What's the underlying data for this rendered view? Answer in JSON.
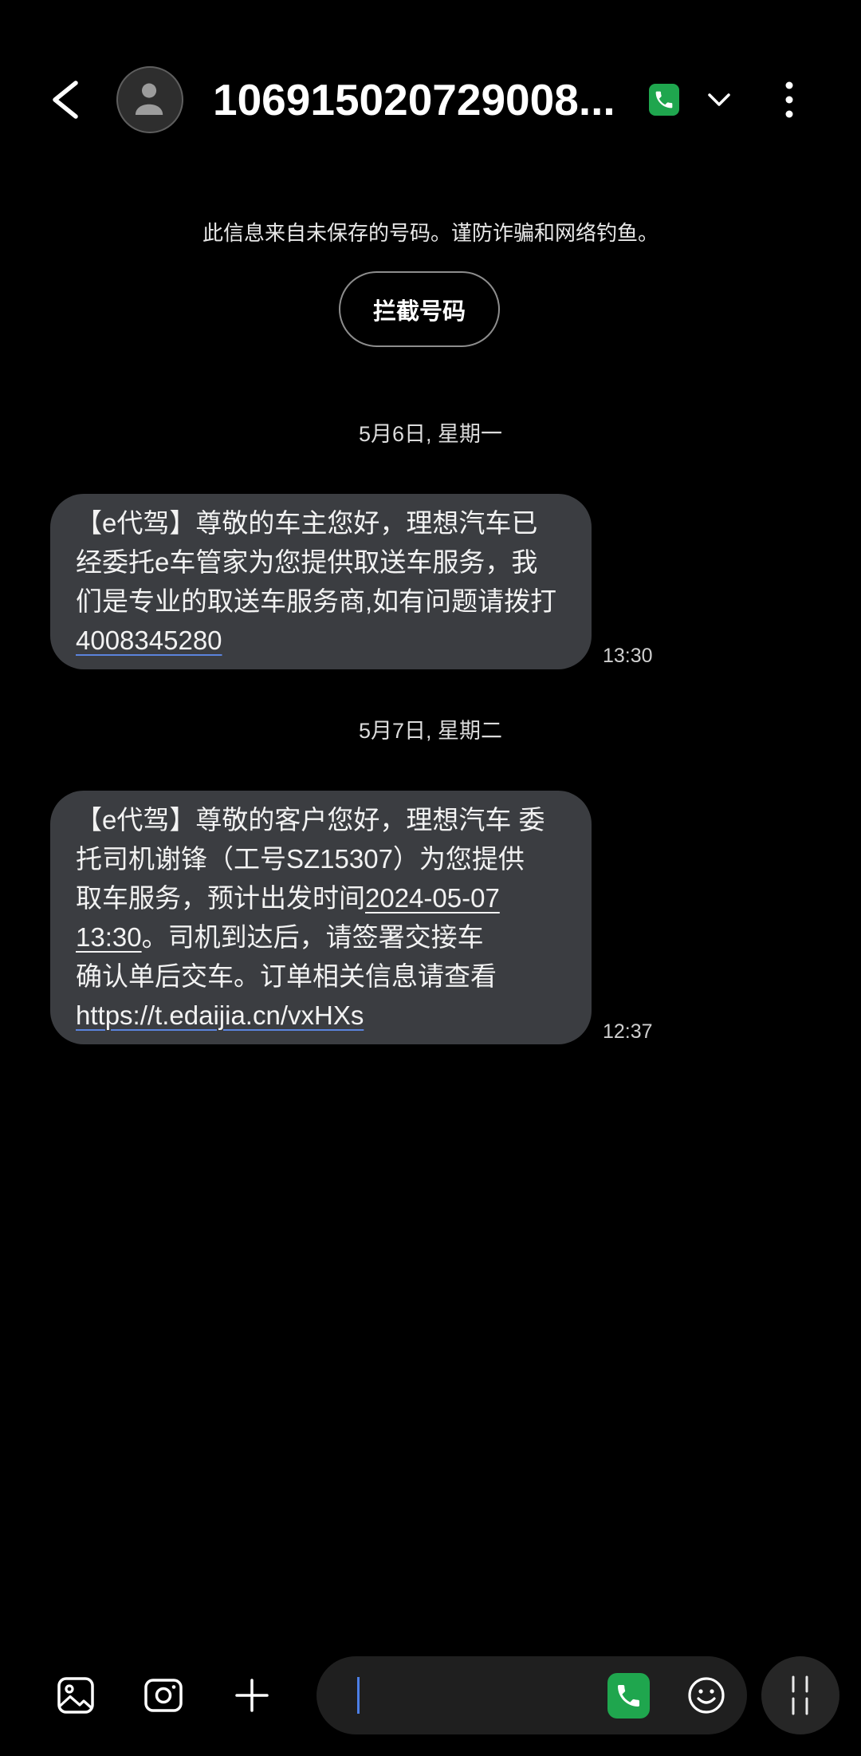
{
  "colors": {
    "background": "#000000",
    "bubble": "#3b3d41",
    "composer_field": "#1f1f1f",
    "voice_button": "#262626",
    "call_green": "#1fa64e",
    "link_underline": "#5b83dc",
    "caret": "#4c7fe6",
    "muted_text": "#cfcfcf"
  },
  "header": {
    "back_icon": "back-arrow-icon",
    "avatar_icon": "person-icon",
    "title": "106915020729008...",
    "call_icon": "phone-icon",
    "expand_icon": "chevron-down-icon",
    "menu_icon": "more-vertical-icon"
  },
  "notice": {
    "text": "此信息来自未保存的号码。谨防诈骗和网络钓鱼。",
    "block_button_label": "拦截号码"
  },
  "conversation": [
    {
      "date": "5月6日, 星期一",
      "message": {
        "lines": [
          [
            {
              "text": "【e代驾】尊敬的车主您好，理想汽车已"
            }
          ],
          [
            {
              "text": "经委托e车管家为您提供取送车服务，我"
            }
          ],
          [
            {
              "text": "们是专业的取送车服务商,如有问题请拨打"
            }
          ],
          [
            {
              "text": "4008345280",
              "link": true
            }
          ]
        ],
        "time": "13:30"
      }
    },
    {
      "date": "5月7日, 星期二",
      "message": {
        "lines": [
          [
            {
              "text": "【e代驾】尊敬的客户您好，理想汽车 委"
            }
          ],
          [
            {
              "text": "托司机谢锋（工号SZ15307）为您提供"
            }
          ],
          [
            {
              "text": "取车服务，预计出发时间"
            },
            {
              "text": "2024-05-07",
              "link": true
            }
          ],
          [
            {
              "text": "13:30",
              "link": true
            },
            {
              "text": "。司机到达后，请签署交接车"
            }
          ],
          [
            {
              "text": "确认单后交车。订单相关信息请查看"
            }
          ],
          [
            {
              "text": "https://t.edaijia.cn/vxHXs",
              "link": true
            }
          ]
        ],
        "time": "12:37"
      }
    }
  ],
  "composer": {
    "gallery_icon": "gallery-icon",
    "camera_icon": "camera-icon",
    "attach_icon": "plus-icon",
    "input_value": "",
    "call_icon": "phone-icon",
    "emoji_icon": "emoji-icon",
    "voice_icon": "voice-input-icon"
  }
}
